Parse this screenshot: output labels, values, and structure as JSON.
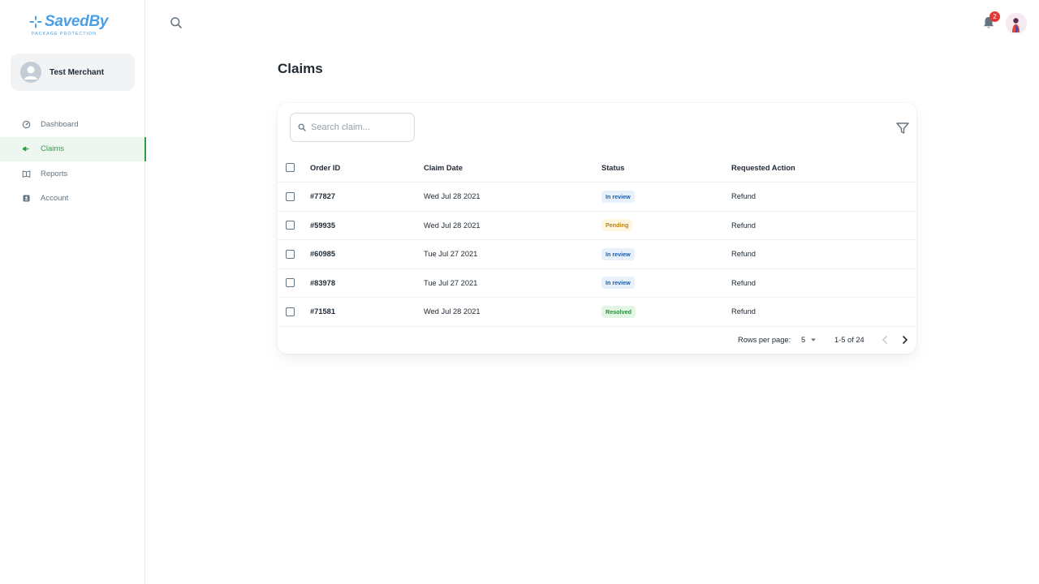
{
  "brand": {
    "name": "SavedBy",
    "tagline": "PACKAGE PROTECTION",
    "color": "#4aa0e6"
  },
  "merchant": {
    "name": "Test Merchant"
  },
  "sidebar": {
    "items": [
      {
        "label": "Dashboard",
        "icon": "dashboard-icon",
        "active": false
      },
      {
        "label": "Claims",
        "icon": "claims-icon",
        "active": true
      },
      {
        "label": "Reports",
        "icon": "reports-icon",
        "active": false
      },
      {
        "label": "Account",
        "icon": "account-icon",
        "active": false
      }
    ]
  },
  "topbar": {
    "notification_count": "2",
    "search_icon": "search-icon",
    "bell_icon": "bell-icon"
  },
  "page": {
    "title": "Claims"
  },
  "search": {
    "placeholder": "Search claim..."
  },
  "table": {
    "headers": {
      "order_id": "Order ID",
      "claim_date": "Claim Date",
      "status": "Status",
      "requested_action": "Requested Action"
    },
    "rows": [
      {
        "order_id": "#77827",
        "claim_date": "Wed Jul 28 2021",
        "status": "In review",
        "status_kind": "review",
        "requested_action": "Refund"
      },
      {
        "order_id": "#59935",
        "claim_date": "Wed Jul 28 2021",
        "status": "Pending",
        "status_kind": "pending",
        "requested_action": "Refund"
      },
      {
        "order_id": "#60985",
        "claim_date": "Tue Jul 27 2021",
        "status": "In review",
        "status_kind": "review",
        "requested_action": "Refund"
      },
      {
        "order_id": "#83978",
        "claim_date": "Tue Jul 27 2021",
        "status": "In review",
        "status_kind": "review",
        "requested_action": "Refund"
      },
      {
        "order_id": "#71581",
        "claim_date": "Wed Jul 28 2021",
        "status": "Resolved",
        "status_kind": "resolved",
        "requested_action": "Refund"
      }
    ]
  },
  "pagination": {
    "rows_per_page_label": "Rows per page:",
    "rows_per_page": "5",
    "range": "1-5 of 24"
  },
  "colors": {
    "accent": "#2e9e47",
    "review": "#1c5fa8",
    "pending": "#b7821a",
    "resolved": "#2a8a3e"
  }
}
